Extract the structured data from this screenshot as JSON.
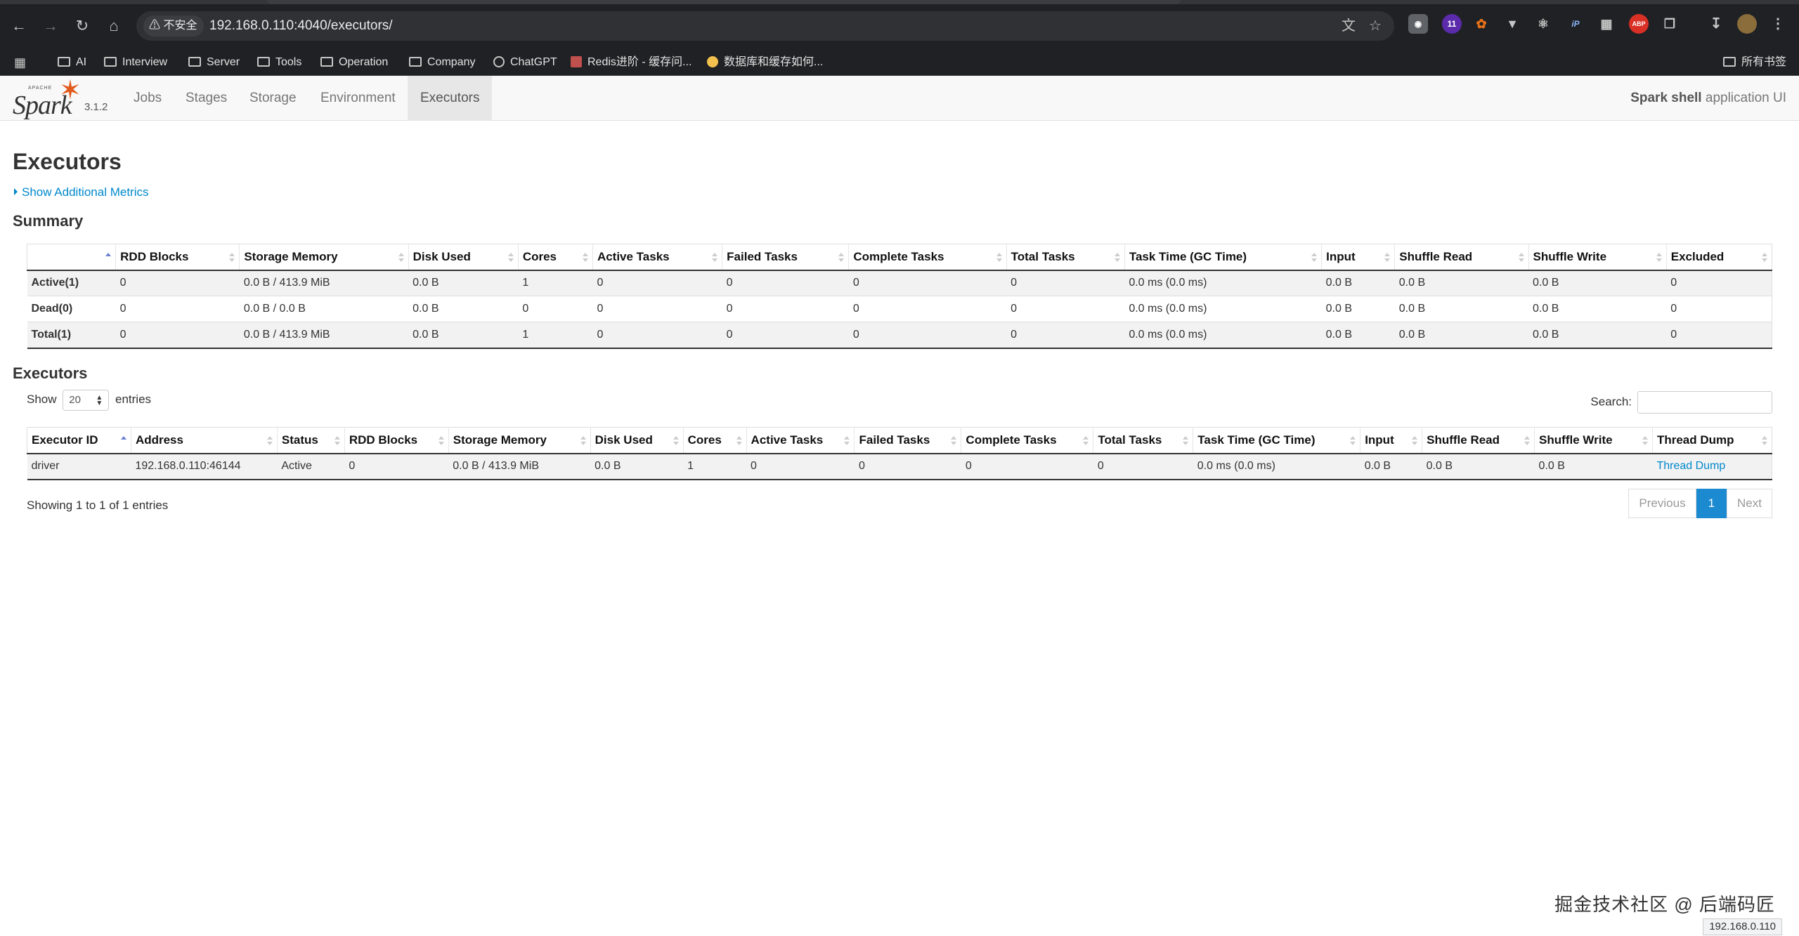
{
  "browser": {
    "security_label": "不安全",
    "url": "192.168.0.110:4040/executors/",
    "ext_badge": "11",
    "ext_abp": "ABP",
    "ext_ip": "iP",
    "bookmarks": [
      {
        "label": "AI",
        "type": "folder"
      },
      {
        "label": "Interview",
        "type": "folder"
      },
      {
        "label": "Server",
        "type": "folder"
      },
      {
        "label": "Tools",
        "type": "folder"
      },
      {
        "label": "Operation",
        "type": "folder"
      },
      {
        "label": "Company",
        "type": "folder"
      },
      {
        "label": "ChatGPT",
        "type": "site"
      },
      {
        "label": "Redis进阶 - 缓存问...",
        "type": "site"
      },
      {
        "label": "数据库和缓存如何...",
        "type": "site"
      }
    ],
    "all_bookmarks": "所有书签"
  },
  "spark": {
    "logo_word": "Spark",
    "logo_apache": "APACHE",
    "version": "3.1.2",
    "tabs": [
      "Jobs",
      "Stages",
      "Storage",
      "Environment",
      "Executors"
    ],
    "active_tab": "Executors",
    "app_name_bold": "Spark shell",
    "app_name_rest": " application UI"
  },
  "page": {
    "title": "Executors",
    "additional_metrics": "Show Additional Metrics",
    "summary_heading": "Summary",
    "executors_heading": "Executors"
  },
  "summary": {
    "headers": [
      "",
      "RDD Blocks",
      "Storage Memory",
      "Disk Used",
      "Cores",
      "Active Tasks",
      "Failed Tasks",
      "Complete Tasks",
      "Total Tasks",
      "Task Time (GC Time)",
      "Input",
      "Shuffle Read",
      "Shuffle Write",
      "Excluded"
    ],
    "rows": [
      [
        "Active(1)",
        "0",
        "0.0 B / 413.9 MiB",
        "0.0 B",
        "1",
        "0",
        "0",
        "0",
        "0",
        "0.0 ms (0.0 ms)",
        "0.0 B",
        "0.0 B",
        "0.0 B",
        "0"
      ],
      [
        "Dead(0)",
        "0",
        "0.0 B / 0.0 B",
        "0.0 B",
        "0",
        "0",
        "0",
        "0",
        "0",
        "0.0 ms (0.0 ms)",
        "0.0 B",
        "0.0 B",
        "0.0 B",
        "0"
      ],
      [
        "Total(1)",
        "0",
        "0.0 B / 413.9 MiB",
        "0.0 B",
        "1",
        "0",
        "0",
        "0",
        "0",
        "0.0 ms (0.0 ms)",
        "0.0 B",
        "0.0 B",
        "0.0 B",
        "0"
      ]
    ]
  },
  "executors": {
    "show_label": "Show",
    "entries_label": "entries",
    "page_size": "20",
    "search_label": "Search:",
    "headers": [
      "Executor ID",
      "Address",
      "Status",
      "RDD Blocks",
      "Storage Memory",
      "Disk Used",
      "Cores",
      "Active Tasks",
      "Failed Tasks",
      "Complete Tasks",
      "Total Tasks",
      "Task Time (GC Time)",
      "Input",
      "Shuffle Read",
      "Shuffle Write",
      "Thread Dump"
    ],
    "rows": [
      [
        "driver",
        "192.168.0.110:46144",
        "Active",
        "0",
        "0.0 B / 413.9 MiB",
        "0.0 B",
        "1",
        "0",
        "0",
        "0",
        "0",
        "0.0 ms (0.0 ms)",
        "0.0 B",
        "0.0 B",
        "0.0 B",
        "Thread Dump"
      ]
    ],
    "info": "Showing 1 to 1 of 1 entries",
    "pager": {
      "previous": "Previous",
      "current": "1",
      "next": "Next"
    }
  },
  "overlay": {
    "watermark": "掘金技术社区 @ 后端码匠",
    "status_url": "192.168.0.110"
  }
}
